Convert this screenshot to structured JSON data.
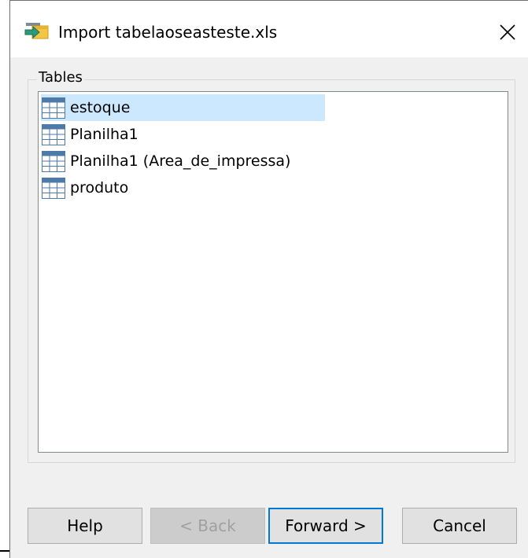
{
  "window": {
    "title": "Import tabelaoseasteste.xls",
    "close_label": "×"
  },
  "tables_group": {
    "label": "Tables",
    "items": [
      {
        "label": "estoque",
        "selected": true
      },
      {
        "label": "Planilha1",
        "selected": false
      },
      {
        "label": "Planilha1 (Area_de_impressa)",
        "selected": false
      },
      {
        "label": "produto",
        "selected": false
      }
    ]
  },
  "buttons": {
    "help": "Help",
    "back": "< Back",
    "forward": "Forward >",
    "cancel": "Cancel"
  },
  "colors": {
    "selection": "#cce8ff",
    "default_button_border": "#0078d7",
    "dialog_background": "#f0f0f0"
  },
  "icons": {
    "title": "import-arrow-folder-icon",
    "item": "table-grid-icon",
    "close": "close-icon"
  }
}
